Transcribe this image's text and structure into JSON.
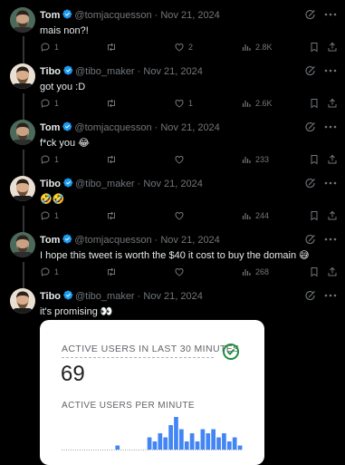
{
  "tweets": [
    {
      "author": "Tom",
      "handle": "@tomjacquesson",
      "date": "Nov 21, 2024",
      "text": "mais non?!",
      "replies": "1",
      "retweets": "",
      "likes": "2",
      "views": "2.8K"
    },
    {
      "author": "Tibo",
      "handle": "@tibo_maker",
      "date": "Nov 21, 2024",
      "text": "got you :D",
      "replies": "1",
      "retweets": "",
      "likes": "1",
      "views": "2.6K"
    },
    {
      "author": "Tom",
      "handle": "@tomjacquesson",
      "date": "Nov 21, 2024",
      "text": "f*ck you 😂",
      "replies": "1",
      "retweets": "",
      "likes": "",
      "views": "233"
    },
    {
      "author": "Tibo",
      "handle": "@tibo_maker",
      "date": "Nov 21, 2024",
      "text": "🤣🤣",
      "replies": "1",
      "retweets": "",
      "likes": "",
      "views": "244"
    },
    {
      "author": "Tom",
      "handle": "@tomjacquesson",
      "date": "Nov 21, 2024",
      "text": "I hope this tweet is worth the $40 it cost to buy the domain 😅",
      "replies": "1",
      "retweets": "",
      "likes": "",
      "views": "268"
    },
    {
      "author": "Tibo",
      "handle": "@tibo_maker",
      "date": "Nov 21, 2024",
      "text": "it's promising 👀"
    }
  ],
  "separator": "·",
  "card": {
    "title": "ACTIVE USERS IN LAST 30 MINUTES",
    "value": "69",
    "subtitle": "ACTIVE USERS PER MINUTE"
  },
  "chart_data": {
    "type": "bar",
    "values": [
      0,
      0,
      0,
      0,
      0,
      0,
      0,
      0,
      0,
      0,
      1,
      0,
      0,
      0,
      0,
      0,
      3,
      2,
      4,
      3,
      6,
      8,
      5,
      2,
      4,
      2,
      5,
      4,
      5,
      3,
      4,
      2,
      3,
      1
    ]
  },
  "colors": {
    "background": "#000000",
    "text": "#e7e9ea",
    "muted": "#71767b",
    "verified": "#1d9bf0",
    "bar": "#4285f4"
  }
}
